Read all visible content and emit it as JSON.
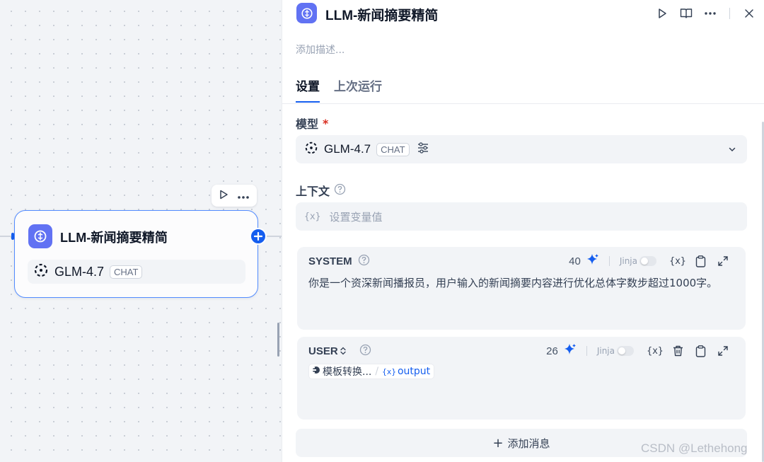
{
  "canvas": {
    "node": {
      "title": "LLM-新闻摘要精简",
      "model_name": "GLM-4.7",
      "model_mode": "CHAT",
      "icon": "llm-brain-icon"
    },
    "toolbar_icons": [
      "run-icon",
      "more-icon"
    ]
  },
  "panel": {
    "title": "LLM-新闻摘要精简",
    "description_placeholder": "添加描述...",
    "tabs": [
      {
        "label": "设置",
        "active": true
      },
      {
        "label": "上次运行",
        "active": false
      }
    ],
    "model": {
      "label": "模型",
      "required_mark": "*",
      "name": "GLM-4.7",
      "mode": "CHAT"
    },
    "context": {
      "label": "上下文",
      "var_glyph": "{x}",
      "placeholder": "设置变量值"
    },
    "messages": [
      {
        "role": "SYSTEM",
        "count": "40",
        "jinja": "Jinja",
        "text": "你是一个资深新闻播报员，用户输入的新闻摘要内容进行优化总体字数步超过1000字。"
      },
      {
        "role": "USER",
        "count": "26",
        "jinja": "Jinja",
        "chip_node": "模板转换...",
        "chip_slash": "/",
        "chip_var_glyph": "{x}",
        "chip_var": "output"
      }
    ],
    "add_message": "添加消息",
    "add_message_plus": "+"
  },
  "watermark": "CSDN @Lethehong",
  "colors": {
    "accent": "#155eef",
    "node_icon_bg": "#6172f3",
    "required": "#d92d20"
  }
}
